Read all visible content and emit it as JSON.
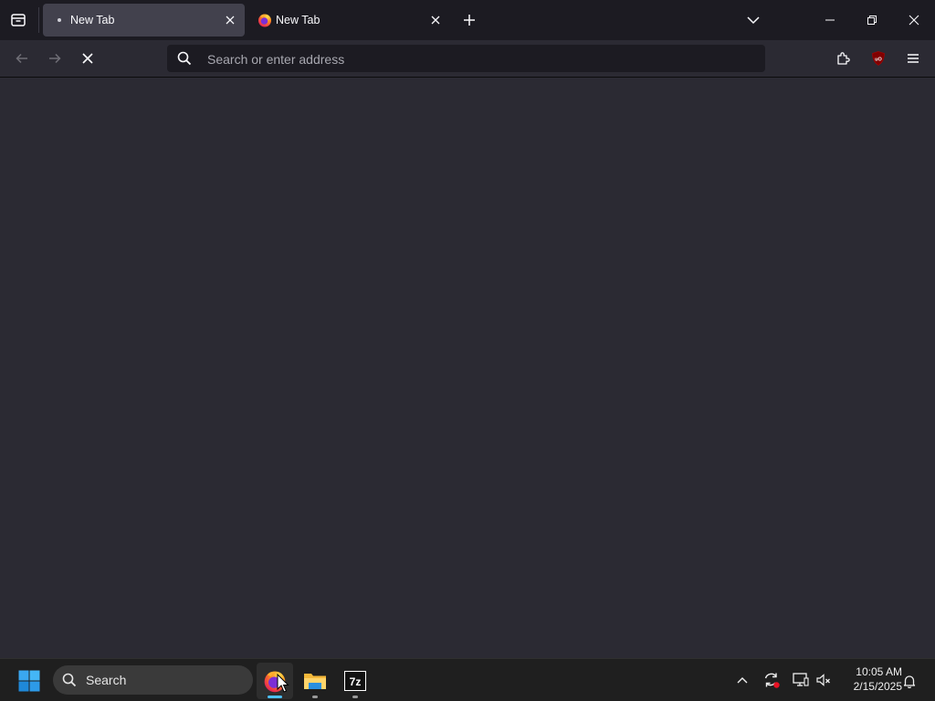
{
  "browser": {
    "tabs": [
      {
        "title": "New Tab",
        "active": true,
        "loading": true
      },
      {
        "title": "New Tab",
        "active": false,
        "icon": "firefox-icon"
      }
    ],
    "urlbar": {
      "placeholder": "Search or enter address",
      "value": ""
    },
    "nav_state": {
      "reload_button": "stop"
    }
  },
  "taskbar": {
    "search_label": "Search",
    "apps": [
      {
        "name": "Firefox",
        "icon": "firefox-icon",
        "active": true
      },
      {
        "name": "File Explorer",
        "icon": "folder-icon",
        "active": false
      },
      {
        "name": "7-Zip",
        "icon": "7zip-icon",
        "label": "7z",
        "active": false
      }
    ],
    "clock": {
      "time": "10:05 AM",
      "date": "2/15/2025"
    }
  },
  "colors": {
    "tabstrip_bg": "#1c1b22",
    "toolbar_bg": "#2b2a33",
    "active_tab_bg": "#42414d",
    "taskbar_bg": "#1f1f1f",
    "taskbar_active_indicator": "#4cc2ff",
    "ublock_red": "#800000"
  }
}
